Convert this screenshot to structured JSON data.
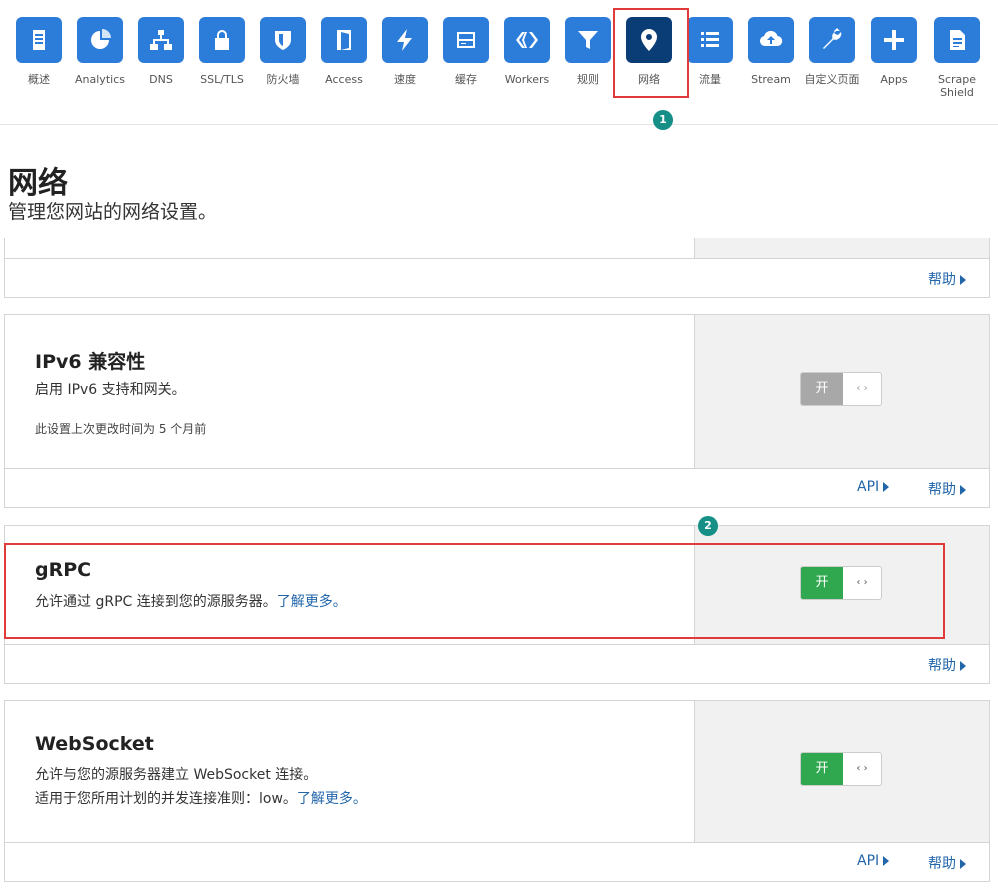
{
  "nav": {
    "items": [
      {
        "label": "概述",
        "icon": "document-icon"
      },
      {
        "label": "Analytics",
        "icon": "pie-chart-icon"
      },
      {
        "label": "DNS",
        "icon": "network-icon"
      },
      {
        "label": "SSL/TLS",
        "icon": "lock-icon"
      },
      {
        "label": "防火墙",
        "icon": "shield-icon"
      },
      {
        "label": "Access",
        "icon": "door-icon"
      },
      {
        "label": "速度",
        "icon": "lightning-icon"
      },
      {
        "label": "缓存",
        "icon": "server-icon"
      },
      {
        "label": "Workers",
        "icon": "workers-icon"
      },
      {
        "label": "规则",
        "icon": "filter-icon"
      },
      {
        "label": "网络",
        "icon": "location-pin-icon",
        "active": true
      },
      {
        "label": "流量",
        "icon": "list-icon"
      },
      {
        "label": "Stream",
        "icon": "cloud-upload-icon"
      },
      {
        "label": "自定义页面",
        "icon": "wrench-icon"
      },
      {
        "label": "Apps",
        "icon": "plus-icon"
      },
      {
        "label": "Scrape Shield",
        "icon": "file-icon"
      }
    ],
    "accent_color": "#2c7cd9",
    "active_color": "#0a3d75"
  },
  "annotations": {
    "badge1": "1",
    "badge2": "2",
    "highlight_color": "#e03a3a",
    "badge_color": "#168f86"
  },
  "page": {
    "title": "网络",
    "subtitle": "管理您网站的网络设置。"
  },
  "cards": {
    "top": {
      "help": "帮助"
    },
    "ipv6": {
      "title": "IPv6 兼容性",
      "desc": "启用 IPv6 支持和网关。",
      "note": "此设置上次更改时间为 5 个月前",
      "toggle_on": "开",
      "toggle_state": "disabled",
      "api": "API",
      "help": "帮助"
    },
    "grpc": {
      "title": "gRPC",
      "desc": "允许通过 gRPC 连接到您的源服务器。",
      "link": "了解更多。",
      "toggle_on": "开",
      "toggle_state": "on",
      "help": "帮助"
    },
    "websocket": {
      "title": "WebSocket",
      "desc1": "允许与您的源服务器建立 WebSocket 连接。",
      "desc2": "适用于您所用计划的并发连接准则：low。",
      "link": "了解更多。",
      "toggle_on": "开",
      "toggle_state": "on",
      "api": "API",
      "help": "帮助"
    }
  },
  "toggle_handle": "‹ ›"
}
